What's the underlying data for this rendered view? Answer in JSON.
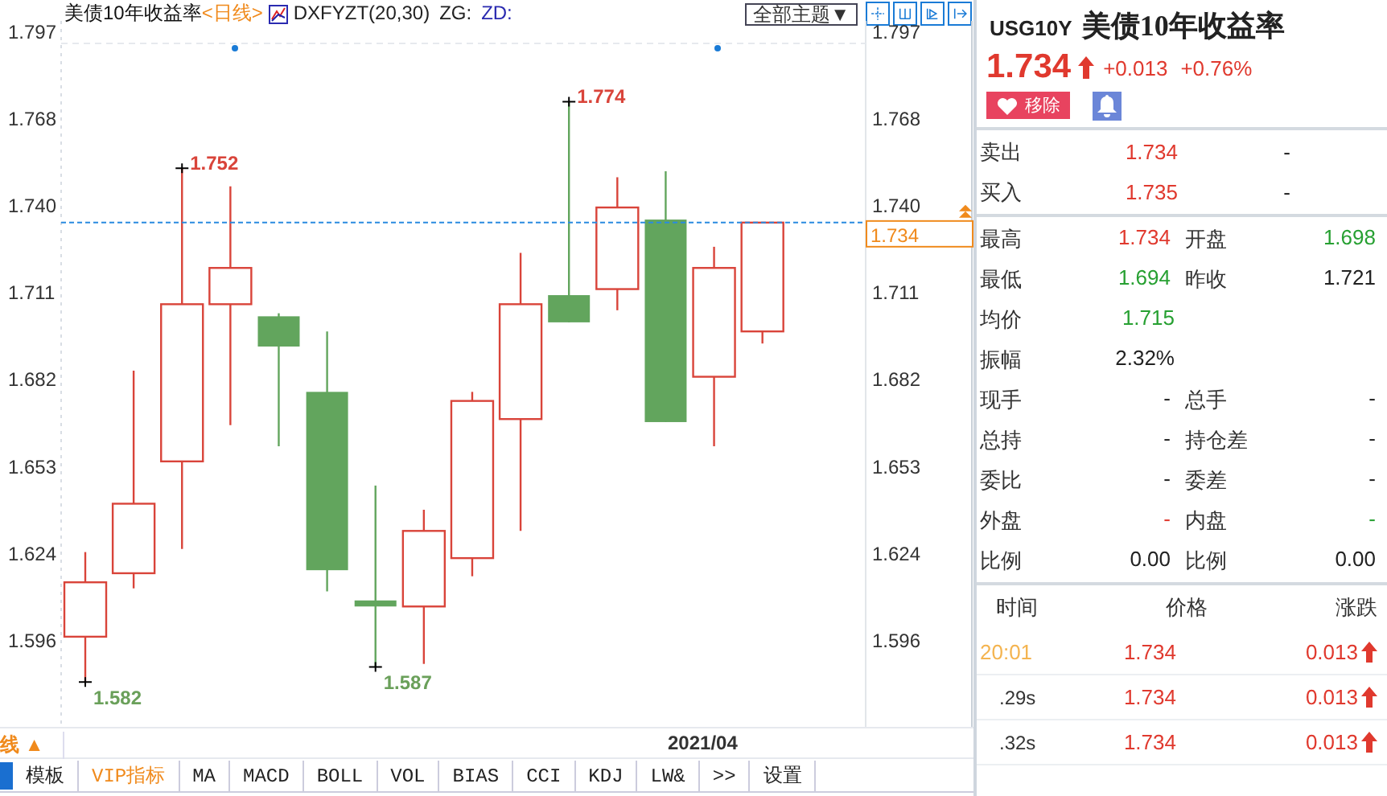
{
  "header": {
    "title": "美债10年收益率",
    "period": "<日线>",
    "indicator": "DXFYZT(20,30)",
    "zg_label": "ZG:",
    "zd_label": "ZD:",
    "theme_button": "全部主题▼"
  },
  "chart": {
    "left_axis_labels": [
      "1.797",
      "1.768",
      "1.740",
      "1.711",
      "1.682",
      "1.653",
      "1.624",
      "1.596"
    ],
    "right_axis_labels": [
      "1.797",
      "1.768",
      "1.740",
      "1.711",
      "1.682",
      "1.653",
      "1.624",
      "1.596"
    ],
    "extreme_labels": [
      {
        "text": "1.752",
        "kind": "high"
      },
      {
        "text": "1.774",
        "kind": "high"
      },
      {
        "text": "1.582",
        "kind": "low"
      },
      {
        "text": "1.587",
        "kind": "low"
      }
    ],
    "current_price": "1.734",
    "date_label": "2021/04",
    "period_label": "线 ▲"
  },
  "indicator_tabs": [
    {
      "label": "模板",
      "highlighted": false
    },
    {
      "label": "VIP指标",
      "highlighted": true
    },
    {
      "label": "MA",
      "highlighted": false
    },
    {
      "label": "MACD",
      "highlighted": false
    },
    {
      "label": "BOLL",
      "highlighted": false
    },
    {
      "label": "VOL",
      "highlighted": false
    },
    {
      "label": "BIAS",
      "highlighted": false
    },
    {
      "label": "CCI",
      "highlighted": false
    },
    {
      "label": "KDJ",
      "highlighted": false
    },
    {
      "label": "LW&",
      "highlighted": false
    },
    {
      "label": ">>",
      "highlighted": false
    },
    {
      "label": "设置",
      "highlighted": false
    }
  ],
  "quote": {
    "symbol": "USG10Y",
    "name": "美债10年收益率",
    "price": "1.734",
    "rising": true,
    "change": "+0.013",
    "change_pct": "+0.76%",
    "remove_button": "移除"
  },
  "order_book": [
    {
      "label": "卖出",
      "value": "1.734",
      "color": "#e0392e",
      "volume": "-"
    },
    {
      "label": "买入",
      "value": "1.735",
      "color": "#e0392e",
      "volume": "-"
    }
  ],
  "stats": [
    [
      {
        "label": "最高",
        "value": "1.734",
        "color": "#e0392e"
      },
      {
        "label": "开盘",
        "value": "1.698",
        "color": "#27a032"
      }
    ],
    [
      {
        "label": "最低",
        "value": "1.694",
        "color": "#27a032"
      },
      {
        "label": "昨收",
        "value": "1.721",
        "color": "#222222"
      }
    ],
    [
      {
        "label": "均价",
        "value": "1.715",
        "color": "#27a032"
      }
    ],
    [
      {
        "label": "振幅",
        "value": "2.32%",
        "color": "#222222"
      }
    ],
    [
      {
        "label": "现手",
        "value": "-",
        "color": "#222222"
      },
      {
        "label": "总手",
        "value": "-",
        "color": "#222222"
      }
    ],
    [
      {
        "label": "总持",
        "value": "-",
        "color": "#222222"
      },
      {
        "label": "持仓差",
        "value": "-",
        "color": "#222222"
      }
    ],
    [
      {
        "label": "委比",
        "value": "-",
        "color": "#222222"
      },
      {
        "label": "委差",
        "value": "-",
        "color": "#222222"
      }
    ],
    [
      {
        "label": "外盘",
        "value": "-",
        "color": "#e0392e"
      },
      {
        "label": "内盘",
        "value": "-",
        "color": "#27a032"
      }
    ],
    [
      {
        "label": "比例",
        "value": "0.00",
        "color": "#222222"
      },
      {
        "label": "比例",
        "value": "0.00",
        "color": "#222222"
      }
    ]
  ],
  "ticks": {
    "columns": [
      "时间",
      "价格",
      "涨跌"
    ],
    "rows": [
      {
        "time": "20:01",
        "kind": "minute",
        "price": "1.734",
        "change": "0.013",
        "rising": true
      },
      {
        "time": ".29s",
        "kind": "second",
        "price": "1.734",
        "change": "0.013",
        "rising": true
      },
      {
        "time": ".32s",
        "kind": "second",
        "price": "1.734",
        "change": "0.013",
        "rising": true
      }
    ]
  }
}
